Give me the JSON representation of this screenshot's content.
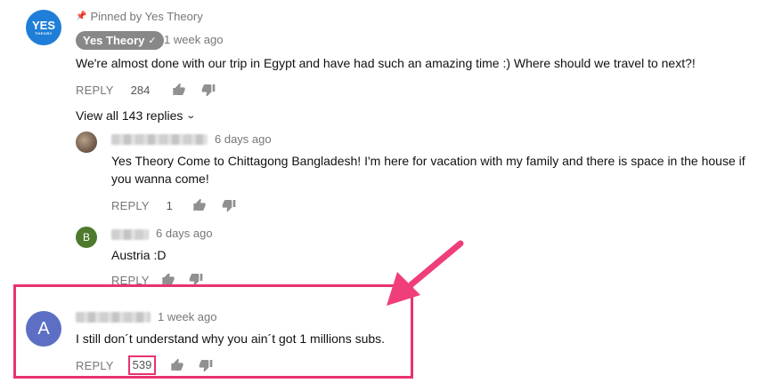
{
  "pinned": {
    "pinned_label": "Pinned by Yes Theory",
    "avatar_text": "YES",
    "author": "Yes Theory",
    "time": "1 week ago",
    "text": "We're almost done with our trip in Egypt and have had such an amazing time :) Where should we travel to next?!",
    "reply_label": "REPLY",
    "likes": "284",
    "view_replies": "View all 143 replies"
  },
  "replies": [
    {
      "time": "6 days ago",
      "text_line1": "Yes Theory Come to Chittagong Bangladesh! I'm here for vacation with my family and there is space in the house if",
      "text_line2": "you wanna come!",
      "reply_label": "REPLY",
      "likes": "1"
    },
    {
      "avatar_letter": "B",
      "time": "6 days ago",
      "text": "Austria :D",
      "reply_label": "REPLY"
    }
  ],
  "highlighted": {
    "avatar_letter": "A",
    "time": "1 week ago",
    "text": "I still don´t understand why you ain´t got 1 millions subs.",
    "reply_label": "REPLY",
    "likes": "539"
  },
  "colors": {
    "highlight": "#e8336e",
    "avatar_yes": "#1f7ed8",
    "avatar_b": "#4e7a2d",
    "avatar_a": "#5c6fc4"
  }
}
